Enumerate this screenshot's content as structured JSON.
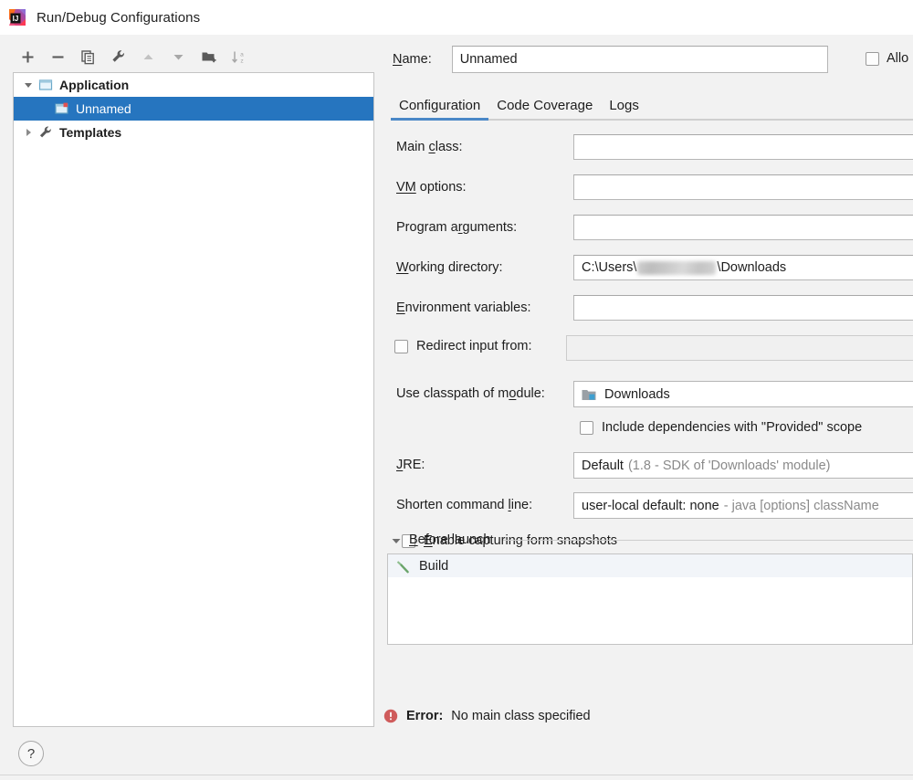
{
  "window": {
    "title": "Run/Debug Configurations",
    "app_icon": "intellij-idea-icon"
  },
  "toolbar": {
    "buttons": [
      {
        "name": "add-configuration-button",
        "icon": "plus-icon",
        "tooltip": "Add New Configuration"
      },
      {
        "name": "remove-configuration-button",
        "icon": "minus-icon",
        "tooltip": "Remove Configuration"
      },
      {
        "name": "copy-configuration-button",
        "icon": "copy-icon",
        "tooltip": "Copy Configuration"
      },
      {
        "name": "edit-templates-button",
        "icon": "wrench-icon",
        "tooltip": "Edit Templates"
      },
      {
        "name": "move-up-button",
        "icon": "arrow-up-icon",
        "tooltip": "Move Up"
      },
      {
        "name": "move-down-button",
        "icon": "arrow-down-icon",
        "tooltip": "Move Down"
      },
      {
        "name": "new-folder-button",
        "icon": "folder-add-icon",
        "tooltip": "Create New Folder"
      },
      {
        "name": "sort-configurations-button",
        "icon": "sort-alpha-icon",
        "tooltip": "Sort Configurations"
      }
    ]
  },
  "tree": {
    "nodes": [
      {
        "label": "Application",
        "level": 0,
        "expanded": true,
        "selected": false,
        "icon": "application-icon"
      },
      {
        "label": "Unnamed",
        "level": 1,
        "expanded": null,
        "selected": true,
        "icon": "configuration-icon"
      },
      {
        "label": "Templates",
        "level": 0,
        "expanded": false,
        "selected": false,
        "icon": "wrench-icon"
      }
    ]
  },
  "help": {
    "label": "?"
  },
  "name_field": {
    "label": "Name:",
    "mnemonic": "N",
    "value": "Unnamed",
    "placeholder": ""
  },
  "allow_parallel": {
    "label": "Allow parallel run",
    "visible_label": "Allo",
    "checked": false
  },
  "tabs": {
    "active": "Configuration",
    "items": [
      {
        "label": "Configuration"
      },
      {
        "label": "Code Coverage"
      },
      {
        "label": "Logs"
      }
    ]
  },
  "accent_color": "#4a88c7",
  "selection_color": "#2675bf",
  "error_color": "#cf5b5b",
  "form": {
    "main_class": {
      "label_before": "Main ",
      "mnemonic": "c",
      "label_after": "lass:",
      "value": "",
      "placeholder": ""
    },
    "vm_options": {
      "label_before": "",
      "mnemonic": "VM",
      "label_after": " options:",
      "value": "",
      "placeholder": ""
    },
    "program_arguments": {
      "label_before": "Program a",
      "mnemonic": "r",
      "label_after": "guments:",
      "value": "",
      "placeholder": ""
    },
    "working_directory": {
      "label_before": "",
      "mnemonic": "W",
      "label_after": "orking directory:",
      "value_prefix": "C:\\Users\\",
      "value_redacted": true,
      "value_suffix": "\\Downloads"
    },
    "environment_variables": {
      "label_before": "",
      "mnemonic": "E",
      "label_after": "nvironment variables:",
      "value": "",
      "placeholder": ""
    },
    "redirect_input": {
      "label": "Redirect input from:",
      "checked": false,
      "value": "",
      "enabled": false
    },
    "use_classpath_of_module": {
      "label_before": "Use classpath of m",
      "mnemonic": "o",
      "label_after": "dule:",
      "value": "Downloads",
      "icon": "module-icon"
    },
    "include_provided": {
      "label": "Include dependencies with \"Provided\" scope",
      "checked": false
    },
    "jre": {
      "label_before": "",
      "mnemonic": "J",
      "label_after": "RE:",
      "value": "Default",
      "value_hint": "(1.8 - SDK of 'Downloads' module)"
    },
    "shorten_command_line": {
      "label_before": "Shorten command ",
      "mnemonic": "l",
      "label_after": "ine:",
      "value": "user-local default: none",
      "value_hint": "- java [options] className"
    },
    "enable_capturing": {
      "label_before": "",
      "mnemonic": "E",
      "label_after": "nable capturing form snapshots",
      "checked": false
    }
  },
  "before_launch": {
    "header_before": "",
    "header_mnemonic": "B",
    "header_after": "efore launch",
    "expanded": true,
    "items": [
      {
        "label": "Build",
        "icon": "hammer-icon",
        "selected": true
      }
    ]
  },
  "error": {
    "icon": "error-icon",
    "label": "Error:",
    "message": "No main class specified"
  }
}
